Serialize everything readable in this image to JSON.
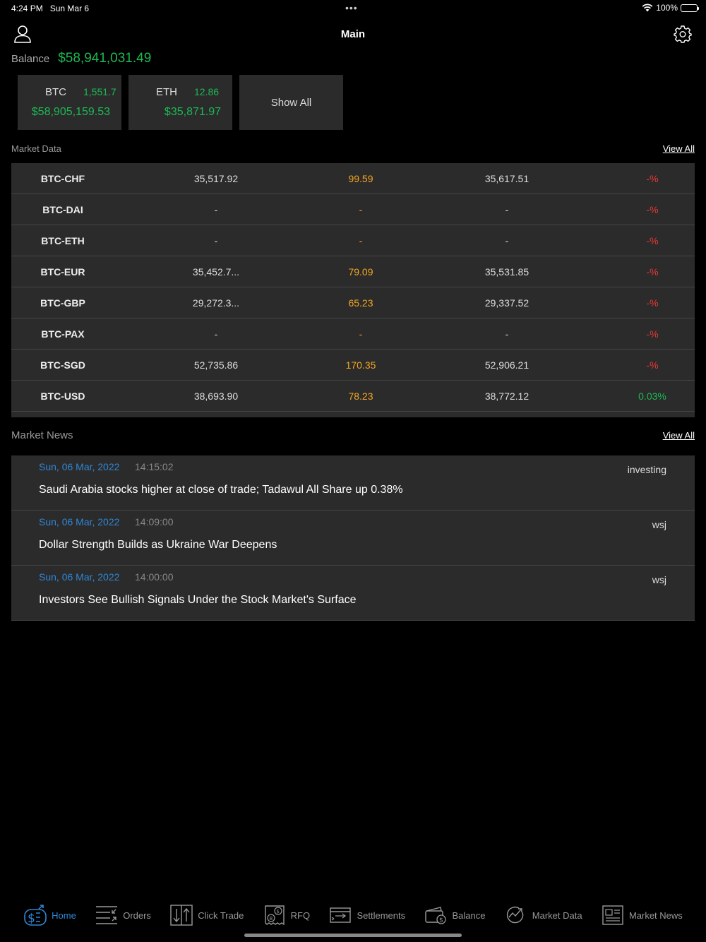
{
  "status": {
    "time": "4:24 PM",
    "date": "Sun Mar 6",
    "battery": "100%"
  },
  "header": {
    "title": "Main"
  },
  "balance": {
    "label": "Balance",
    "value": "$58,941,031.49"
  },
  "assets": [
    {
      "symbol": "BTC",
      "qty": "1,551.7",
      "value": "$58,905,159.53"
    },
    {
      "symbol": "ETH",
      "qty": "12.86",
      "value": "$35,871.97"
    }
  ],
  "show_all": "Show All",
  "market": {
    "title": "Market Data",
    "view_all": "View All",
    "rows": [
      {
        "pair": "BTC-CHF",
        "bid": "35,517.92",
        "spread": "99.59",
        "ask": "35,617.51",
        "change": "-%",
        "dir": "neg"
      },
      {
        "pair": "BTC-DAI",
        "bid": "-",
        "spread": "-",
        "ask": "-",
        "change": "-%",
        "dir": "neg"
      },
      {
        "pair": "BTC-ETH",
        "bid": "-",
        "spread": "-",
        "ask": "-",
        "change": "-%",
        "dir": "neg"
      },
      {
        "pair": "BTC-EUR",
        "bid": "35,452.7...",
        "spread": "79.09",
        "ask": "35,531.85",
        "change": "-%",
        "dir": "neg"
      },
      {
        "pair": "BTC-GBP",
        "bid": "29,272.3...",
        "spread": "65.23",
        "ask": "29,337.52",
        "change": "-%",
        "dir": "neg"
      },
      {
        "pair": "BTC-PAX",
        "bid": "-",
        "spread": "-",
        "ask": "-",
        "change": "-%",
        "dir": "neg"
      },
      {
        "pair": "BTC-SGD",
        "bid": "52,735.86",
        "spread": "170.35",
        "ask": "52,906.21",
        "change": "-%",
        "dir": "neg"
      },
      {
        "pair": "BTC-USD",
        "bid": "38,693.90",
        "spread": "78.23",
        "ask": "38,772.12",
        "change": "0.03%",
        "dir": "pos"
      }
    ]
  },
  "news": {
    "title": "Market News",
    "view_all": "View All",
    "items": [
      {
        "date": "Sun, 06 Mar, 2022",
        "time": "14:15:02",
        "source": "investing",
        "headline": "Saudi Arabia stocks higher at close of trade; Tadawul All Share up 0.38%"
      },
      {
        "date": "Sun, 06 Mar, 2022",
        "time": "14:09:00",
        "source": "wsj",
        "headline": "Dollar Strength Builds as Ukraine War Deepens"
      },
      {
        "date": "Sun, 06 Mar, 2022",
        "time": "14:00:00",
        "source": "wsj",
        "headline": "Investors See Bullish Signals Under the Stock Market's Surface"
      }
    ]
  },
  "tabs": [
    {
      "label": "Home",
      "icon": "home-dollar-icon",
      "active": true
    },
    {
      "label": "Orders",
      "icon": "orders-icon",
      "active": false
    },
    {
      "label": "Click Trade",
      "icon": "click-trade-icon",
      "active": false
    },
    {
      "label": "RFQ",
      "icon": "rfq-icon",
      "active": false
    },
    {
      "label": "Settlements",
      "icon": "settlements-icon",
      "active": false
    },
    {
      "label": "Balance",
      "icon": "balance-icon",
      "active": false
    },
    {
      "label": "Market Data",
      "icon": "market-data-icon",
      "active": false
    },
    {
      "label": "Market News",
      "icon": "market-news-icon",
      "active": false
    }
  ],
  "colors": {
    "accent": "#2f86d6",
    "positive": "#1db954",
    "negative": "#e53935",
    "spread": "#f5a623"
  }
}
